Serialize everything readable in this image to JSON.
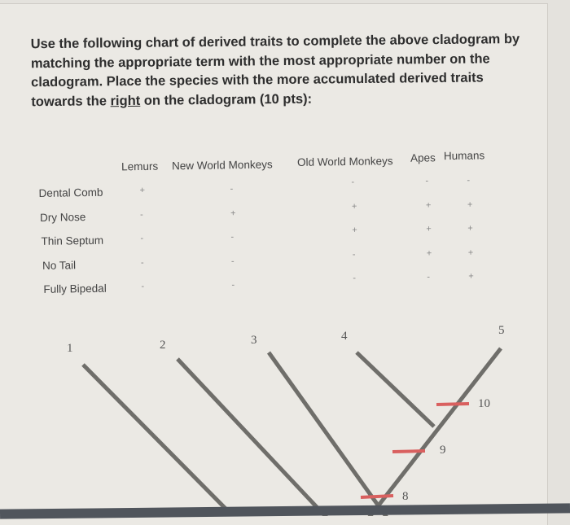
{
  "prompt": {
    "text": "Use the following chart of derived traits to complete the above cladogram by matching the appropriate term with the most appropriate number on the cladogram. Place the species with the more accumulated derived traits towards the ",
    "underlined": "right",
    "tail": " on the cladogram (10 pts):"
  },
  "table": {
    "columns": [
      "Lemurs",
      "New World Monkeys",
      "Old World Monkeys",
      "Apes",
      "Humans"
    ],
    "rows": [
      {
        "trait": "Dental Comb",
        "values": [
          "+",
          "-",
          "-",
          "-",
          "-"
        ]
      },
      {
        "trait": "Dry Nose",
        "values": [
          "-",
          "+",
          "+",
          "+",
          "+"
        ]
      },
      {
        "trait": "Thin Septum",
        "values": [
          "-",
          "-",
          "+",
          "+",
          "+"
        ]
      },
      {
        "trait": "No Tail",
        "values": [
          "-",
          "-",
          "-",
          "+",
          "+"
        ]
      },
      {
        "trait": "Fully Bipedal",
        "values": [
          "-",
          "-",
          "-",
          "-",
          "+"
        ]
      }
    ]
  },
  "cladogram": {
    "tips": [
      "1",
      "2",
      "3",
      "4",
      "5"
    ],
    "nodes": [
      "8",
      "9",
      "10"
    ],
    "marker_color": "#d9605f"
  }
}
